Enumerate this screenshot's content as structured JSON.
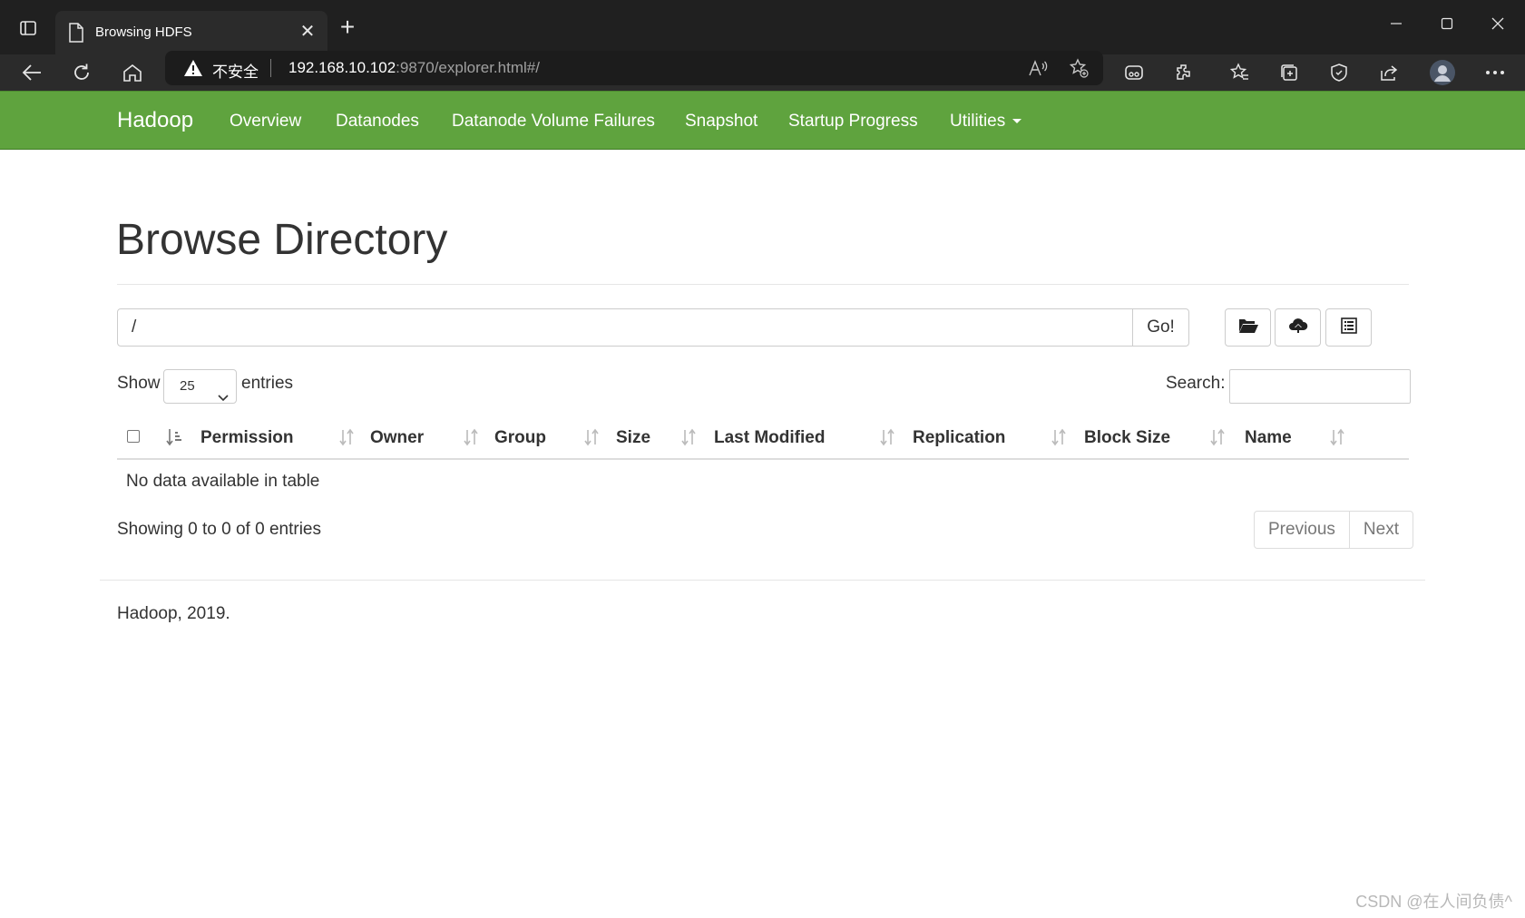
{
  "browser": {
    "tab_title": "Browsing HDFS",
    "tab_close": "✕",
    "new_tab": "+",
    "insecure_label": "不安全",
    "url_host": "192.168.10.102",
    "url_path": ":9870/explorer.html#/"
  },
  "navbar": {
    "brand": "Hadoop",
    "items": [
      "Overview",
      "Datanodes",
      "Datanode Volume Failures",
      "Snapshot",
      "Startup Progress",
      "Utilities"
    ]
  },
  "page": {
    "title": "Browse Directory",
    "path_value": "/",
    "go_label": "Go!"
  },
  "table_controls": {
    "show_label": "Show",
    "page_size": "25",
    "entries_label": "entries",
    "search_label": "Search:"
  },
  "table": {
    "columns": [
      "Permission",
      "Owner",
      "Group",
      "Size",
      "Last Modified",
      "Replication",
      "Block Size",
      "Name"
    ],
    "empty_message": "No data available in table",
    "info": "Showing 0 to 0 of 0 entries",
    "prev_label": "Previous",
    "next_label": "Next"
  },
  "footer": {
    "text": "Hadoop, 2019."
  },
  "watermark": "CSDN @在人间负债^",
  "colors": {
    "navbar_bg": "#5fa33e",
    "chrome_dark": "#202020"
  }
}
